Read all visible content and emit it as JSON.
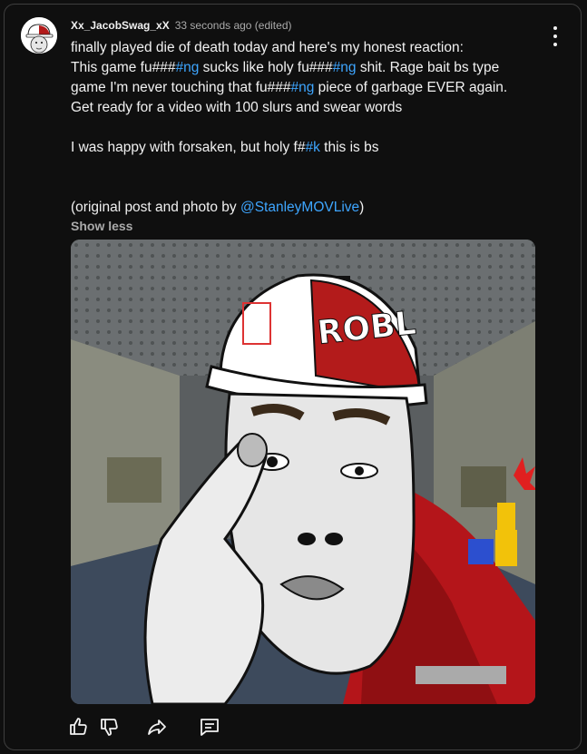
{
  "comment": {
    "author": "Xx_JacobSwag_xX",
    "timestamp": "33 seconds ago (edited)",
    "lines": [
      {
        "pre": "finally played die of death today and here's my honest reaction:",
        "blue": "",
        "post": ""
      },
      {
        "pre": "This game fu###",
        "blue": "#ng",
        "post": " sucks like holy fu###",
        "blue2": "#ng",
        "post2": " shit. Rage bait bs type"
      },
      {
        "pre": "game I'm never touching that fu###",
        "blue": "#ng",
        "post": " piece of garbage EVER again."
      },
      {
        "pre": "Get ready for a video with 100 slurs and swear words",
        "blue": "",
        "post": ""
      },
      {
        "pre": "I was happy with forsaken, but holy f#",
        "blue": "#k",
        "post": " this is bs"
      },
      {
        "pre": "(original post and photo by ",
        "mention": "@StanleyMOVLive",
        "post": ")"
      }
    ],
    "show_less": "Show less",
    "image": {
      "alt_icon": "meme-drawing-image",
      "hat_text": "ROBLOX"
    }
  },
  "actions": {
    "like_icon": "thumbs-up-icon",
    "dislike_icon": "thumbs-down-icon",
    "share_icon": "share-icon",
    "reply_icon": "comment-icon"
  },
  "colors": {
    "background": "#0f0f0f",
    "text": "#f1f1f1",
    "secondary": "#aaaaaa",
    "link": "#3ea6ff",
    "border": "#3f3f3f"
  }
}
